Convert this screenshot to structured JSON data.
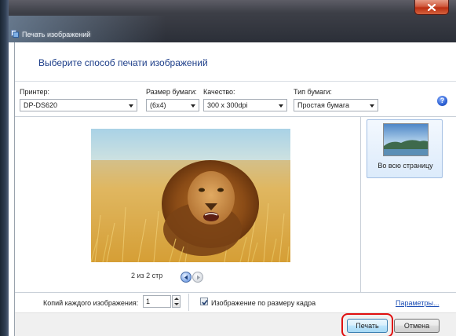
{
  "window": {
    "title": "Печать изображений",
    "close_icon": "close-icon"
  },
  "header": {
    "instruction": "Выберите способ печати изображений"
  },
  "options": {
    "printer": {
      "label": "Принтер:",
      "value": "DP-DS620"
    },
    "paper_size": {
      "label": "Размер бумаги:",
      "value": "(6x4)"
    },
    "quality": {
      "label": "Качество:",
      "value": "300 x 300dpi"
    },
    "paper_type": {
      "label": "Тип бумаги:",
      "value": "Простая бумага"
    },
    "help_icon": "help-icon",
    "help_glyph": "?"
  },
  "preview": {
    "image": "lion-photo",
    "page_counter": "2 из 2 стр"
  },
  "layouts": [
    {
      "label": "Во всю страницу",
      "selected": true
    }
  ],
  "bottom": {
    "copies_label": "Копий каждого изображения:",
    "copies_value": "1",
    "fit_label": "Изображение по размеру кадра",
    "fit_checked": true,
    "params_link": "Параметры..."
  },
  "footer": {
    "print_button": "Печать",
    "cancel_button": "Отмена"
  },
  "colors": {
    "instruction": "#1e3f8a",
    "highlight": "#e01010",
    "link": "#1e4fb5"
  }
}
